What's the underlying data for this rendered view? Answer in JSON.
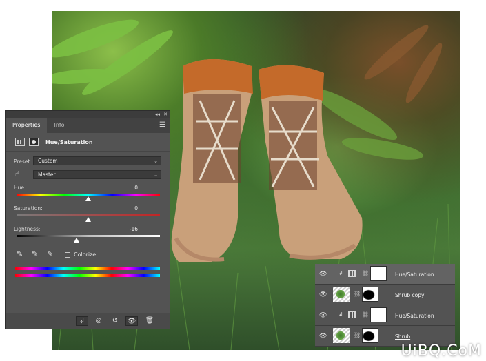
{
  "properties_panel": {
    "window_controls": [
      "◂◂",
      "✕"
    ],
    "tabs": [
      {
        "label": "Properties",
        "active": true
      },
      {
        "label": "Info",
        "active": false
      }
    ],
    "adjustment_title": "Hue/Saturation",
    "preset": {
      "label": "Preset:",
      "value": "Custom"
    },
    "channel": {
      "value": "Master"
    },
    "sliders": [
      {
        "label": "Hue:",
        "value": "0",
        "level": 0
      },
      {
        "label": "Saturation:",
        "value": "0",
        "level": 0
      },
      {
        "label": "Lightness:",
        "value": "-16",
        "level": -16
      }
    ],
    "colorize_label": "Colorize",
    "colorize_checked": false
  },
  "layers_panel": {
    "layers": [
      {
        "name": "Hue/Saturation",
        "kind": "adjustment",
        "clipped": true,
        "selected": true
      },
      {
        "name": "Shrub copy",
        "kind": "image",
        "clipped": false,
        "selected": false
      },
      {
        "name": "Hue/Saturation",
        "kind": "adjustment",
        "clipped": true,
        "selected": false
      },
      {
        "name": "Shrub",
        "kind": "image",
        "clipped": false,
        "selected": false
      }
    ]
  },
  "watermark": "UiBQ.CoM",
  "colors": {
    "panel_bg": "#535353",
    "panel_dark": "#3c3c3c",
    "text": "#e2e2e2"
  }
}
